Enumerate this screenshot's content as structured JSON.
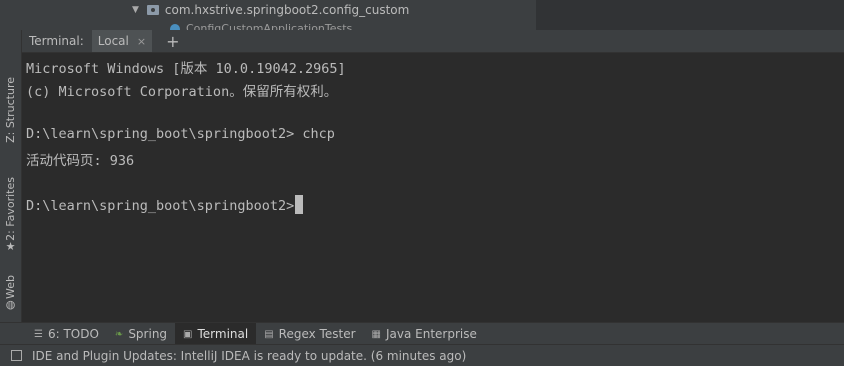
{
  "project_tree": {
    "package_label": "com.hxstrive.springboot2.config_custom",
    "class_label": "ConfigCustomApplicationTests"
  },
  "left_stripe": {
    "structure": "Z: Structure",
    "favorites": "2: Favorites",
    "web": "Web"
  },
  "terminal_tabs": {
    "label": "Terminal:",
    "tab_local": "Local",
    "close_glyph": "×",
    "add_glyph": "+"
  },
  "terminal": {
    "lines": [
      "Microsoft Windows [版本 10.0.19042.2965]",
      "(c) Microsoft Corporation。保留所有权利。",
      "",
      "D:\\learn\\spring_boot\\springboot2> chcp",
      "活动代码页: 936",
      "",
      "D:\\learn\\spring_boot\\springboot2>"
    ]
  },
  "tool_windows": [
    {
      "label": "6: TODO",
      "icon": "list-icon"
    },
    {
      "label": "Spring",
      "icon": "spring-leaf-icon"
    },
    {
      "label": "Terminal",
      "icon": "terminal-icon",
      "active": true
    },
    {
      "label": "Regex Tester",
      "icon": "regex-icon"
    },
    {
      "label": "Java Enterprise",
      "icon": "java-enterprise-icon"
    }
  ],
  "status_bar": {
    "message": "IDE and Plugin Updates: IntelliJ IDEA is ready to update. (6 minutes ago)"
  }
}
